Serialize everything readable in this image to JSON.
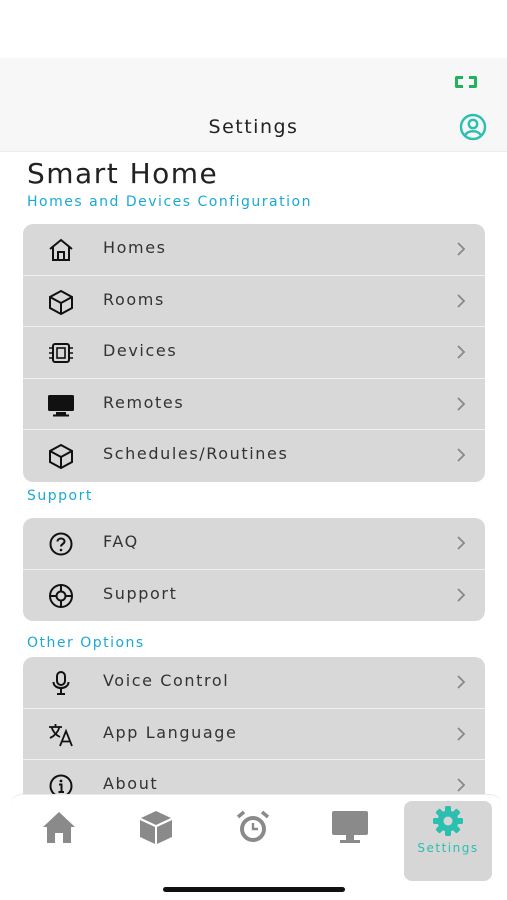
{
  "nav": {
    "title": "Settings"
  },
  "header": {
    "title": "Smart Home",
    "subtitle": "Homes and Devices Configuration"
  },
  "groups": {
    "homes": [
      {
        "label": "Homes",
        "icon": "home-icon"
      },
      {
        "label": "Rooms",
        "icon": "cube-icon"
      },
      {
        "label": "Devices",
        "icon": "chip-icon"
      },
      {
        "label": "Remotes",
        "icon": "monitor-icon"
      },
      {
        "label": "Schedules/Routines",
        "icon": "cube-icon"
      }
    ],
    "support_label": "Support",
    "support": [
      {
        "label": "FAQ",
        "icon": "question-icon"
      },
      {
        "label": "Support",
        "icon": "lifebuoy-icon"
      }
    ],
    "other_label": "Other Options",
    "other": [
      {
        "label": "Voice Control",
        "icon": "microphone-icon"
      },
      {
        "label": "App Language",
        "icon": "translate-icon"
      },
      {
        "label": "About",
        "icon": "info-icon"
      }
    ]
  },
  "tabbar": {
    "tabs": [
      {
        "name": "home",
        "icon": "home-icon",
        "label": ""
      },
      {
        "name": "rooms",
        "icon": "cube-icon",
        "label": ""
      },
      {
        "name": "schedules",
        "icon": "alarm-clock-icon",
        "label": ""
      },
      {
        "name": "remotes",
        "icon": "monitor-icon",
        "label": ""
      },
      {
        "name": "settings",
        "icon": "gear-icon",
        "label": "Settings"
      }
    ],
    "active": "settings"
  },
  "colors": {
    "accent": "#1aa9d6",
    "active_tab": "#2bbfb0",
    "battery": "#22b35a",
    "row_bg": "#d8d8d8",
    "icon_gray": "#8a8a8a"
  }
}
